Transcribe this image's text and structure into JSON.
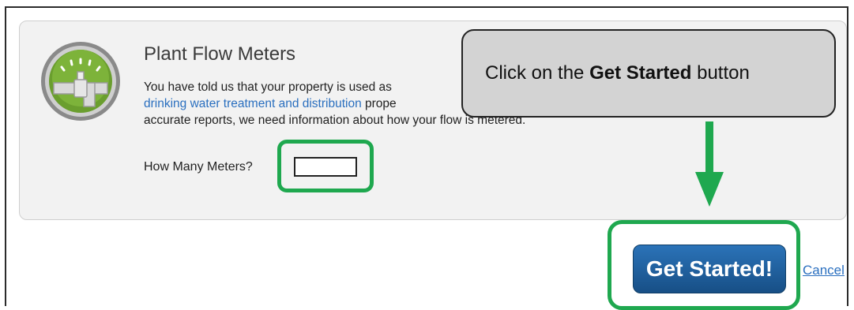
{
  "panel": {
    "title": "Plant Flow Meters",
    "desc_part1": "You have told us that your property is used as",
    "desc_link": "drinking water treatment and distribution",
    "desc_part2": " prope",
    "desc_part3": "accurate reports, we need information about how your flow is metered.",
    "meters_label": "How Many Meters?",
    "meters_value": ""
  },
  "callout": {
    "prefix": "Click on the ",
    "bold": "Get Started",
    "suffix": " button"
  },
  "actions": {
    "get_started": "Get Started!",
    "cancel": "Cancel"
  },
  "colors": {
    "highlight": "#1fa84f",
    "button": "#1f5f9e",
    "link": "#2a6fbf",
    "icon_green": "#7db33a"
  },
  "icons": {
    "meter": "pipe-gauge-icon",
    "arrow": "down-arrow-icon"
  }
}
